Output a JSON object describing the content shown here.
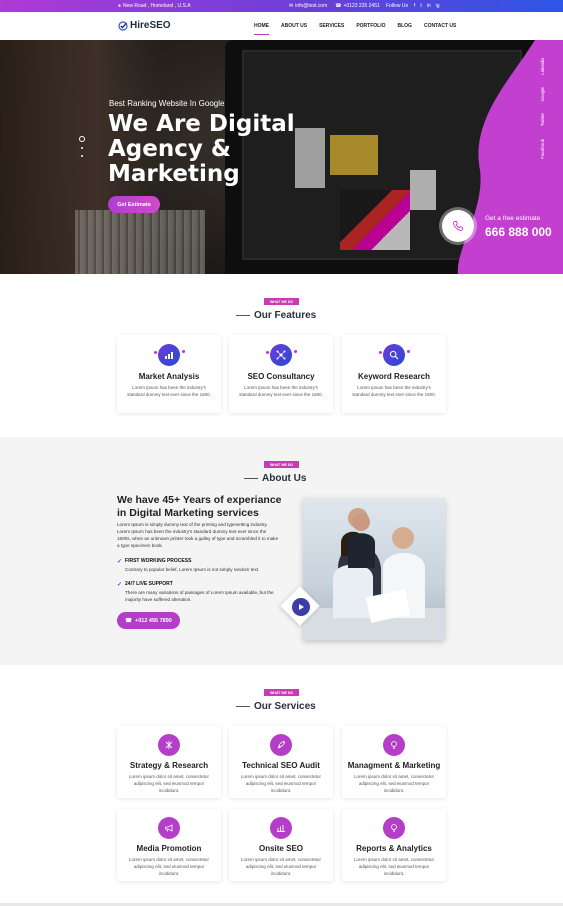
{
  "topbar": {
    "address": "New Road , Homeland , U.S.A",
    "email": "info@test.com",
    "phone": "+0123 235 2451",
    "follow": "Follow Us",
    "social": [
      "f",
      "t",
      "in",
      "ig"
    ]
  },
  "nav": {
    "logo": "HireSEO",
    "items": [
      "HOME",
      "ABOUT US",
      "SERVICES",
      "PORTFOLIO",
      "BLOG",
      "CONTACT US"
    ]
  },
  "hero": {
    "pretitle": "Best Ranking Website In Google",
    "title_lines": [
      "We Are Digital",
      "Agency &",
      "Marketing"
    ],
    "button": "Get Estimate",
    "side_links": [
      "Linkedin",
      "Google",
      "Twitter",
      "Facebook"
    ],
    "estimate_label": "Get a free estimate",
    "estimate_number": "666 888 000"
  },
  "features": {
    "badge": "WHAT WE DO",
    "title": "Our Features",
    "cards": [
      {
        "title": "Market Analysis",
        "desc": "Lorem Ipsum has been the industry's standard dummy text ever since the 1500.",
        "icon": "chart-icon"
      },
      {
        "title": "SEO Consultancy",
        "desc": "Lorem Ipsum has been the industry's standard dummy text ever since the 1500.",
        "icon": "network-icon"
      },
      {
        "title": "Keyword Research",
        "desc": "Lorem Ipsum has been the industry's standard dummy text ever since the 1500.",
        "icon": "search-icon"
      }
    ]
  },
  "about": {
    "badge": "WHAT WE DO",
    "title": "About Us",
    "heading": "We have 45+ Years of experiance in Digital Marketing services",
    "para": "Lorem Ipsum is simply dummy text of the printing and typesetting industry. Lorem Ipsum has been the industry's standard dummy text ever since the 1500s, when an unknown printer took a galley of type and scrambled it to make a type specimen book.",
    "points": [
      {
        "title": "FIRST WORKING PROCESS",
        "desc": "Contrary to popular belief, Lorem Ipsum is not simply random text."
      },
      {
        "title": "24/7 LIVE SUPPORT",
        "desc": "There are many variations of passages of Lorem Ipsum available, but the majority have suffered alteration."
      }
    ],
    "button": "+012 456 7890"
  },
  "services": {
    "badge": "WHAT WE DO",
    "title": "Our Services",
    "cards": [
      {
        "title": "Strategy & Research",
        "desc": "Lorem ipsum dolor sit amet, consectetur adipiscing elit, sed eiusmod tempor incididunt.",
        "icon": "strategy-icon"
      },
      {
        "title": "Technical SEO Audit",
        "desc": "Lorem ipsum dolor sit amet, consectetur adipiscing elit, sed eiusmod tempor incididunt.",
        "icon": "rocket-icon"
      },
      {
        "title": "Managment & Marketing",
        "desc": "Lorem ipsum dolor sit amet, consectetur adipiscing elit, sed eiusmod tempor incididunt.",
        "icon": "bulb-icon"
      },
      {
        "title": "Media Promotion",
        "desc": "Lorem ipsum dolor sit amet, consectetur adipiscing elit, sed eiusmod tempor incididunt.",
        "icon": "megaphone-icon"
      },
      {
        "title": "Onsite SEO",
        "desc": "Lorem ipsum dolor sit amet, consectetur adipiscing elit, sed eiusmod tempor incididunt.",
        "icon": "bar-chart-icon"
      },
      {
        "title": "Reports & Analytics",
        "desc": "Lorem ipsum dolor sit amet, consectetur adipiscing elit, sed eiusmod tempor incididunt.",
        "icon": "bulb-icon"
      }
    ]
  },
  "colors": {
    "accent": "#b53ec8",
    "blue": "#2d55e6",
    "dark": "#2a2f3d"
  }
}
